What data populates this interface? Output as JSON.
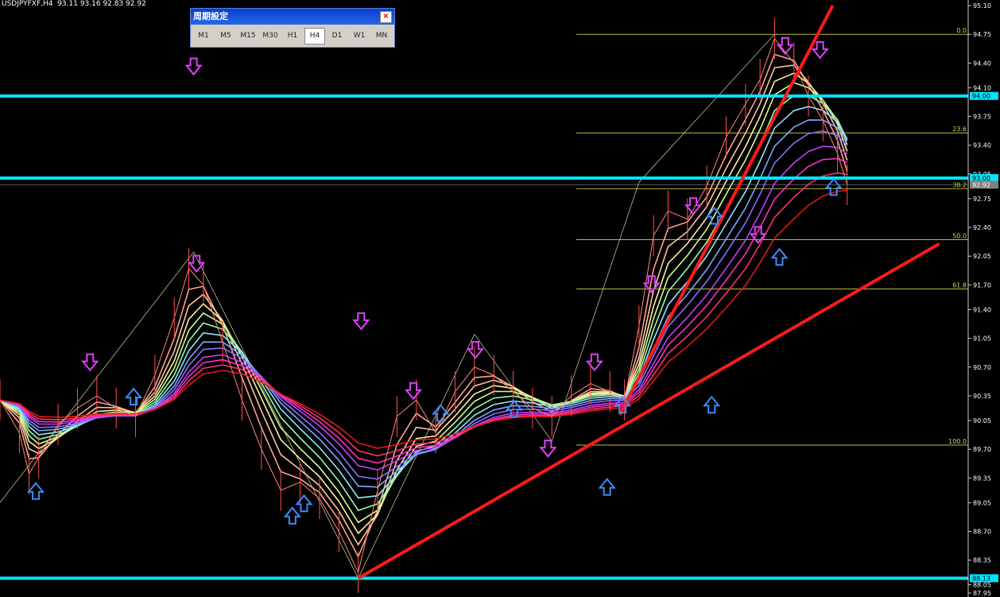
{
  "header": {
    "symbol_line": "USDJPYFXF,H4  93.11 93.16 92.83 92.92"
  },
  "timeframe_panel": {
    "title": "周期設定",
    "close_label": "×",
    "buttons": [
      "M1",
      "M5",
      "M15",
      "M30",
      "H1",
      "H4",
      "D1",
      "W1",
      "MN"
    ],
    "active": "H4"
  },
  "colors": {
    "background": "#000000",
    "level_line": "#00e5ff",
    "trend_line": "#ff1a1a",
    "fib_line": "#d8d84a",
    "down_arrow": "#e040fb",
    "up_arrow": "#3d8bff",
    "axis_text": "#ffffff",
    "level_tag_text": "#000000"
  },
  "chart_data": {
    "type": "line",
    "ylim": [
      87.95,
      95.1
    ],
    "y_ticks": [
      "95.10",
      "94.75",
      "94.40",
      "94.10",
      "93.75",
      "93.40",
      "93.05",
      "92.75",
      "92.40",
      "92.05",
      "91.70",
      "91.40",
      "91.05",
      "90.70",
      "90.35",
      "90.05",
      "89.70",
      "89.35",
      "89.05",
      "88.70",
      "88.35",
      "88.05",
      "87.95"
    ],
    "highlighted_prices": [
      "94.00",
      "93.00",
      "92.92",
      "88.13"
    ],
    "horizontal_levels": [
      {
        "value": 94.0,
        "label": "94.00"
      },
      {
        "value": 93.0,
        "label": "93.00"
      },
      {
        "value": 88.13,
        "label": "88.13"
      }
    ],
    "current_price": {
      "value": 92.92,
      "label": "92.92"
    },
    "fibonacci": [
      {
        "ratio": "0.0",
        "price": 94.75
      },
      {
        "ratio": "23.6",
        "price": 93.55
      },
      {
        "ratio": "38.2",
        "price": 92.87
      },
      {
        "ratio": "50.0",
        "price": 92.25
      },
      {
        "ratio": "61.8",
        "price": 91.65
      },
      {
        "ratio": "100.0",
        "price": 89.75
      }
    ],
    "trend_lines": [
      {
        "from": [
          0.37,
          88.13
        ],
        "to": [
          0.97,
          92.2
        ]
      },
      {
        "from": [
          0.64,
          90.12
        ],
        "to": [
          0.86,
          95.1
        ]
      }
    ],
    "zigzag": [
      [
        0.0,
        89.05
      ],
      [
        0.2,
        92.1
      ],
      [
        0.37,
        88.13
      ],
      [
        0.49,
        91.1
      ],
      [
        0.57,
        89.8
      ],
      [
        0.66,
        92.95
      ],
      [
        0.8,
        94.75
      ]
    ],
    "price_path": [
      [
        0.0,
        90.3
      ],
      [
        0.02,
        89.9
      ],
      [
        0.03,
        89.4
      ],
      [
        0.04,
        89.6
      ],
      [
        0.06,
        90.0
      ],
      [
        0.08,
        90.2
      ],
      [
        0.1,
        90.35
      ],
      [
        0.12,
        90.2
      ],
      [
        0.14,
        90.1
      ],
      [
        0.16,
        90.6
      ],
      [
        0.18,
        91.3
      ],
      [
        0.195,
        91.9
      ],
      [
        0.21,
        91.7
      ],
      [
        0.23,
        91.0
      ],
      [
        0.25,
        90.3
      ],
      [
        0.27,
        89.7
      ],
      [
        0.29,
        89.2
      ],
      [
        0.31,
        89.3
      ],
      [
        0.33,
        89.1
      ],
      [
        0.35,
        88.7
      ],
      [
        0.37,
        88.2
      ],
      [
        0.39,
        89.2
      ],
      [
        0.41,
        90.1
      ],
      [
        0.43,
        90.3
      ],
      [
        0.45,
        89.9
      ],
      [
        0.47,
        90.4
      ],
      [
        0.49,
        90.7
      ],
      [
        0.51,
        90.6
      ],
      [
        0.53,
        90.4
      ],
      [
        0.55,
        90.2
      ],
      [
        0.57,
        90.1
      ],
      [
        0.59,
        90.35
      ],
      [
        0.61,
        90.5
      ],
      [
        0.63,
        90.4
      ],
      [
        0.645,
        90.3
      ],
      [
        0.66,
        91.2
      ],
      [
        0.675,
        92.3
      ],
      [
        0.69,
        92.6
      ],
      [
        0.71,
        92.5
      ],
      [
        0.73,
        92.9
      ],
      [
        0.75,
        93.5
      ],
      [
        0.77,
        93.9
      ],
      [
        0.785,
        94.2
      ],
      [
        0.8,
        94.7
      ],
      [
        0.82,
        94.4
      ],
      [
        0.835,
        94.0
      ],
      [
        0.85,
        93.7
      ],
      [
        0.865,
        93.3
      ],
      [
        0.875,
        92.92
      ]
    ],
    "ma_ribbon": [
      {
        "name": "ma1",
        "color": "#ffa090",
        "lag": 1,
        "smooth": 0.7
      },
      {
        "name": "ma2",
        "color": "#ffc4a0",
        "lag": 2,
        "smooth": 0.55
      },
      {
        "name": "ma3",
        "color": "#fff0a0",
        "lag": 3,
        "smooth": 0.45
      },
      {
        "name": "ma4",
        "color": "#d0ff90",
        "lag": 4,
        "smooth": 0.38
      },
      {
        "name": "ma5",
        "color": "#90ffb0",
        "lag": 5,
        "smooth": 0.32
      },
      {
        "name": "ma6",
        "color": "#90e8ff",
        "lag": 6,
        "smooth": 0.27
      },
      {
        "name": "ma7",
        "color": "#80a8ff",
        "lag": 7,
        "smooth": 0.23
      },
      {
        "name": "ma8",
        "color": "#8870ff",
        "lag": 8,
        "smooth": 0.2
      },
      {
        "name": "ma9",
        "color": "#c040ff",
        "lag": 9,
        "smooth": 0.17
      },
      {
        "name": "ma10",
        "color": "#ff30c0",
        "lag": 10,
        "smooth": 0.15
      },
      {
        "name": "ma11",
        "color": "#ff3070",
        "lag": 11,
        "smooth": 0.13
      },
      {
        "name": "ma12",
        "color": "#e01818",
        "lag": 12,
        "smooth": 0.11
      }
    ],
    "down_arrows": [
      [
        0.2,
        94.35
      ],
      [
        0.093,
        90.75
      ],
      [
        0.203,
        91.95
      ],
      [
        0.373,
        91.25
      ],
      [
        0.427,
        90.4
      ],
      [
        0.491,
        90.9
      ],
      [
        0.566,
        89.7
      ],
      [
        0.614,
        90.75
      ],
      [
        0.673,
        91.7
      ],
      [
        0.716,
        92.65
      ],
      [
        0.783,
        92.3
      ],
      [
        0.811,
        94.6
      ],
      [
        0.847,
        94.55
      ]
    ],
    "up_arrows": [
      [
        0.037,
        89.2
      ],
      [
        0.138,
        90.35
      ],
      [
        0.302,
        88.9
      ],
      [
        0.314,
        89.05
      ],
      [
        0.455,
        90.15
      ],
      [
        0.531,
        90.2
      ],
      [
        0.627,
        89.25
      ],
      [
        0.643,
        90.25
      ],
      [
        0.735,
        90.25
      ],
      [
        0.738,
        92.55
      ],
      [
        0.805,
        92.05
      ],
      [
        0.861,
        92.9
      ]
    ]
  }
}
